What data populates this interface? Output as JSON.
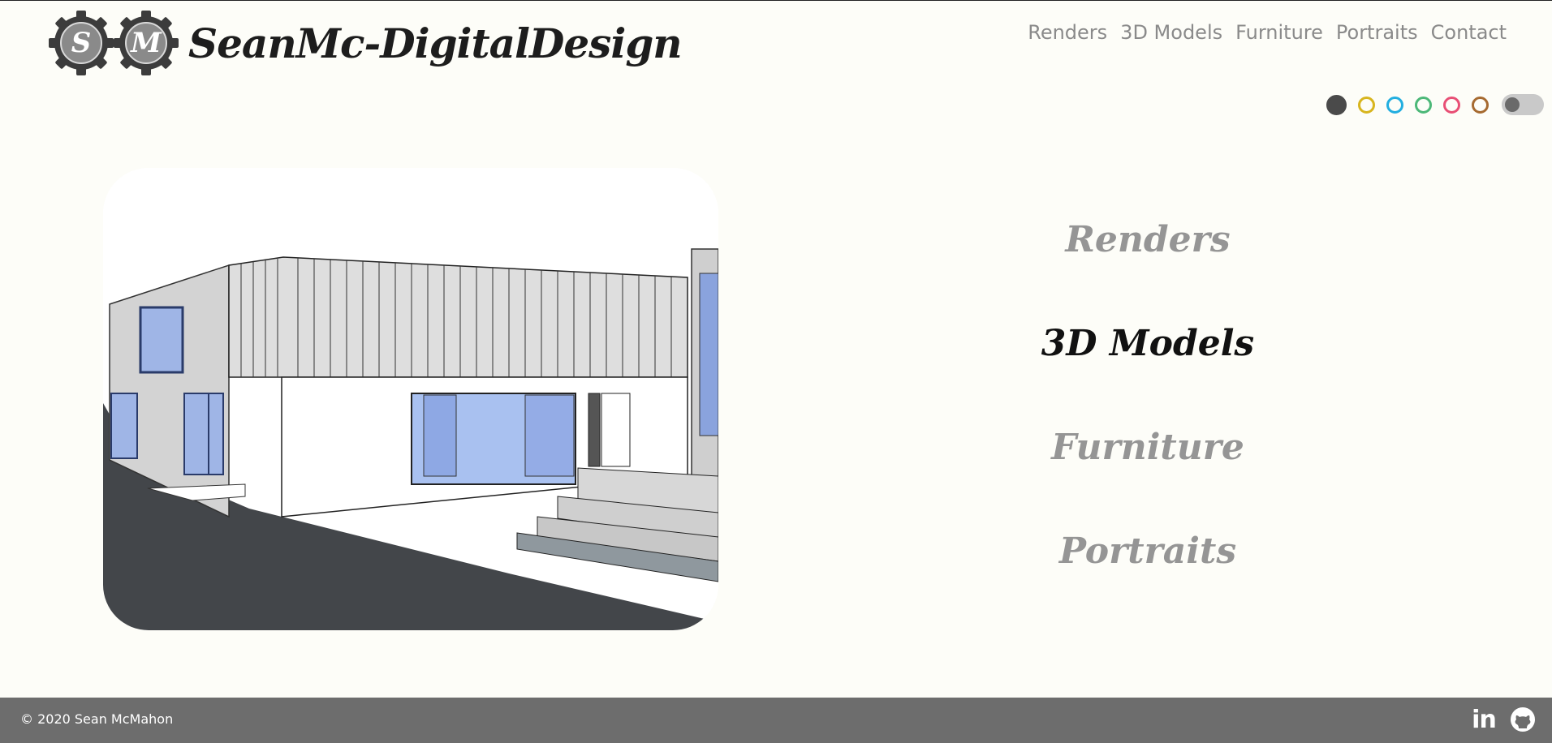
{
  "header": {
    "brand": "SeanMc-DigitalDesign",
    "gear_letters": [
      "S",
      "M"
    ],
    "nav": [
      {
        "label": "Renders"
      },
      {
        "label": "3D Models"
      },
      {
        "label": "Furniture"
      },
      {
        "label": "Portraits"
      },
      {
        "label": "Contact"
      }
    ]
  },
  "theme": {
    "swatches": [
      {
        "name": "dark",
        "color": "#4a4a4a",
        "selected": true
      },
      {
        "name": "yellow",
        "color": "#d8b51e"
      },
      {
        "name": "blue",
        "color": "#22aee0"
      },
      {
        "name": "green",
        "color": "#4cb878"
      },
      {
        "name": "pink",
        "color": "#e84f75"
      },
      {
        "name": "brown",
        "color": "#a66a30"
      }
    ],
    "dark_mode_toggle": false
  },
  "main": {
    "categories": [
      {
        "label": "Renders",
        "active": false
      },
      {
        "label": "3D Models",
        "active": true
      },
      {
        "label": "Furniture",
        "active": false
      },
      {
        "label": "Portraits",
        "active": false
      }
    ]
  },
  "footer": {
    "copyright": "© 2020 Sean McMahon",
    "social": [
      {
        "icon": "linkedin-icon",
        "text": "in"
      },
      {
        "icon": "github-icon"
      }
    ]
  },
  "colors": {
    "background": "#fdfdf8",
    "footer": "#6d6d6d",
    "text_dark": "#1d1d1d",
    "text_muted": "#959595"
  }
}
